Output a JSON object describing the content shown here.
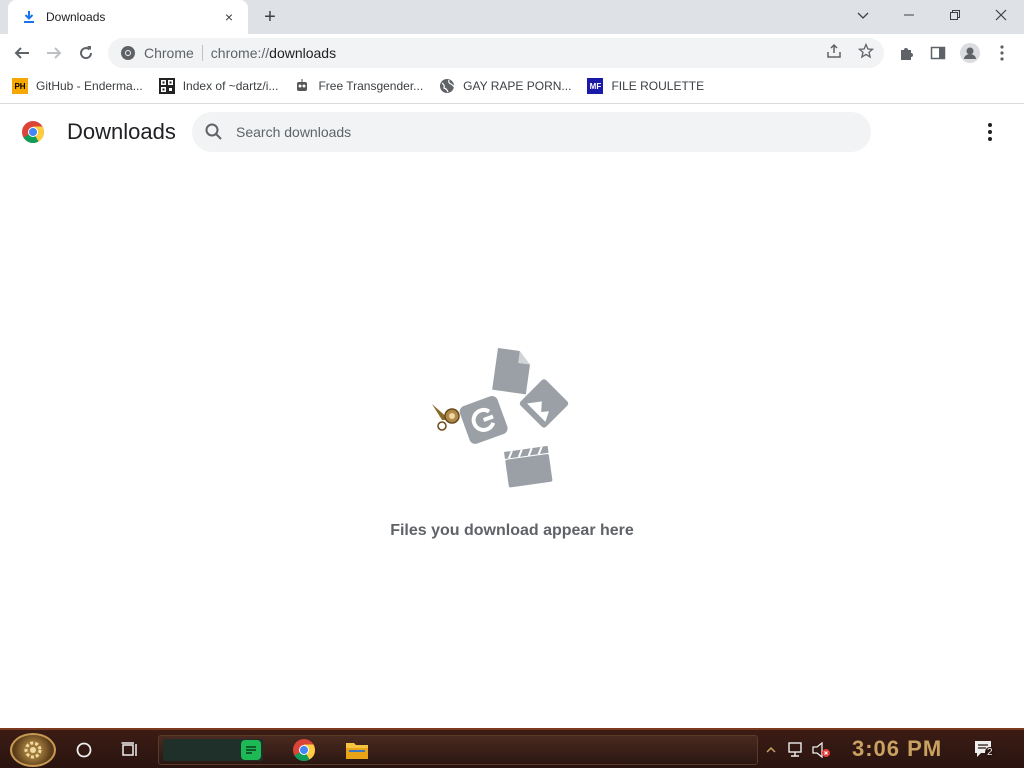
{
  "window": {
    "tab_title": "Downloads",
    "new_tab_symbol": "+",
    "close_tab_symbol": "×"
  },
  "omnibox": {
    "site_label": "Chrome",
    "url_prefix": "chrome://",
    "url_path": "downloads"
  },
  "bookmarks": [
    {
      "label": "GitHub - Enderma...",
      "icon": "ph-icon",
      "icon_text": "PH",
      "icon_bg": "#f7a800",
      "icon_fg": "#000000"
    },
    {
      "label": "Index of ~dartz/i...",
      "icon": "qr-icon",
      "icon_text": "",
      "icon_bg": "#222222",
      "icon_fg": "#ffffff"
    },
    {
      "label": "Free Transgender...",
      "icon": "robot-icon",
      "icon_text": "",
      "icon_bg": "#ffffff",
      "icon_fg": "#333333"
    },
    {
      "label": "GAY RAPE PORN...",
      "icon": "globe-icon",
      "icon_text": "",
      "icon_bg": "#ffffff",
      "icon_fg": "#5f6368"
    },
    {
      "label": "FILE ROULETTE",
      "icon": "mf-icon",
      "icon_text": "MF",
      "icon_bg": "#1a1aa8",
      "icon_fg": "#ffffff"
    }
  ],
  "page": {
    "title": "Downloads",
    "search_placeholder": "Search downloads",
    "empty_message": "Files you download appear here"
  },
  "taskbar": {
    "clock": "3:06 PM",
    "notification_count": "2"
  },
  "colors": {
    "accent_blue": "#1a73e8",
    "spotify_green": "#1db954",
    "clock_gold": "#c9a262",
    "illustration_gray": "#9aa0a6"
  }
}
